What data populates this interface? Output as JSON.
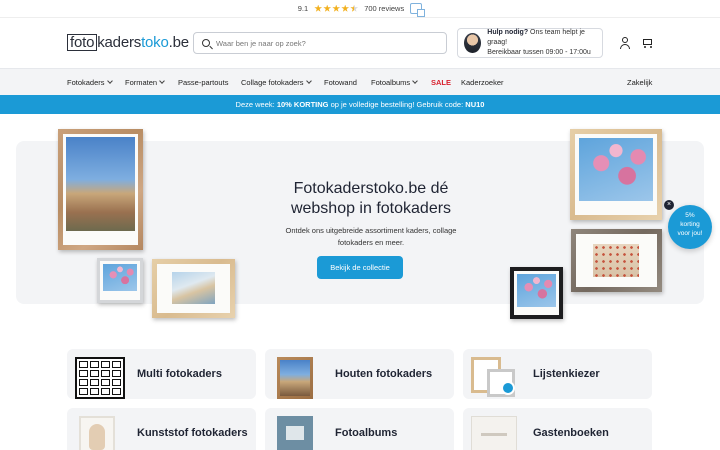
{
  "rating": {
    "score": "9.1",
    "stars": 4.5,
    "reviews": "700 reviews"
  },
  "header": {
    "logo_box": "foto",
    "logo_mid": "kaders",
    "logo_blue": "toko",
    "logo_tld": ".be",
    "search_placeholder": "Waar ben je naar op zoek?",
    "help_title": "Hulp nodig?",
    "help_line1": " Ons team helpt je graag!",
    "help_line2": "Bereikbaar tussen 09:00 - 17:00u"
  },
  "nav": {
    "items": [
      {
        "label": "Fotokaders",
        "dropdown": true
      },
      {
        "label": "Formaten",
        "dropdown": true
      },
      {
        "label": "Passe-partouts",
        "dropdown": false
      },
      {
        "label": "Collage fotokaders",
        "dropdown": true
      },
      {
        "label": "Fotowand",
        "dropdown": false
      },
      {
        "label": "Fotoalbums",
        "dropdown": true
      },
      {
        "label": "SALE",
        "dropdown": false
      },
      {
        "label": "Kaderzoeker",
        "dropdown": false
      }
    ],
    "right": "Zakelijk"
  },
  "promo": {
    "prefix": "Deze week: ",
    "bold1": "10% KORTING",
    "middle": " op je volledige bestelling! Gebruik code: ",
    "code": "NU10"
  },
  "hero": {
    "title": "Fotokaderstoko.be dé webshop in fotokaders",
    "subtitle": "Ontdek ons uitgebreide assortiment kaders, collage fotokaders en meer.",
    "button": "Bekijk de collectie"
  },
  "discount": {
    "line1": "5%",
    "line2": "korting",
    "line3": "voor jou!",
    "close": "×"
  },
  "categories": [
    {
      "label": "Multi fotokaders"
    },
    {
      "label": "Houten fotokaders"
    },
    {
      "label": "Lijstenkiezer"
    },
    {
      "label": "Kunststof fotokaders"
    },
    {
      "label": "Fotoalbums"
    },
    {
      "label": "Gastenboeken"
    }
  ],
  "colors": {
    "accent": "#1b9ad6",
    "sale": "#d8212e",
    "hero_bg": "#f3f4f6",
    "star": "#f2b01e"
  },
  "icons": [
    "star-icon",
    "review-platform-icon",
    "search-icon",
    "user-icon",
    "cart-icon",
    "chevron-down-icon",
    "close-icon"
  ]
}
